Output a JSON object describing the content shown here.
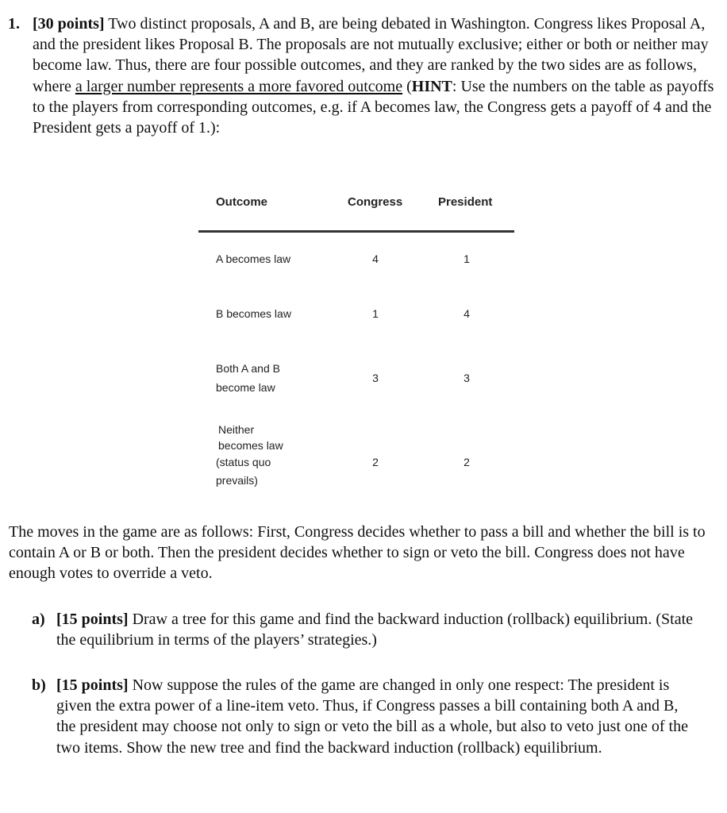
{
  "question": {
    "number": "1.",
    "points": "[30 points]",
    "text_1": " Two distinct proposals, A and B, are being debated in Washington. Congress likes Proposal A, and the president likes Proposal B. The proposals are not mutually exclusive; either or both or neither may become law. Thus, there are four possible outcomes, and they are ranked by the two sides are as follows, where ",
    "underlined": "a larger number represents a more favored outcome",
    "text_2": " (",
    "hint_label": "HINT",
    "text_3": ": Use the numbers on the table as payoffs to the players from corresponding outcomes, e.g. if A becomes law, the Congress gets a payoff of 4 and the President gets a payoff of 1.):"
  },
  "table": {
    "headers": [
      "Outcome",
      "Congress",
      "President"
    ],
    "rows": [
      {
        "outcome": [
          "A becomes law"
        ],
        "congress": "4",
        "president": "1"
      },
      {
        "outcome": [
          "B becomes law"
        ],
        "congress": "1",
        "president": "4"
      },
      {
        "outcome": [
          "Both A and B",
          "become law"
        ],
        "congress": "3",
        "president": "3"
      },
      {
        "outcome": [
          "Neither",
          "becomes law",
          "(status quo",
          "prevails)"
        ],
        "congress": "2",
        "president": "2"
      }
    ]
  },
  "moves_paragraph": "The moves in the game are as follows: First, Congress decides whether to pass a bill and whether the bill is to contain A or B or both. Then the president decides whether to sign or veto the bill. Congress does not have enough votes to override a veto.",
  "parts": [
    {
      "label": "a)",
      "points": "[15 points]",
      "text": " Draw a tree for this game and find the backward induction (rollback) equilibrium. (State the equilibrium in terms of the players’ strategies.)"
    },
    {
      "label": "b)",
      "points": "[15 points]",
      "text": " Now suppose the rules of the game are changed in only one respect: The president is given the extra power of a line-item veto. Thus, if Congress passes a bill containing both A and B, the president may choose not only to sign or veto the bill as a whole, but also to veto just one of the two items. Show the new tree and find the backward induction (rollback) equilibrium."
    }
  ]
}
